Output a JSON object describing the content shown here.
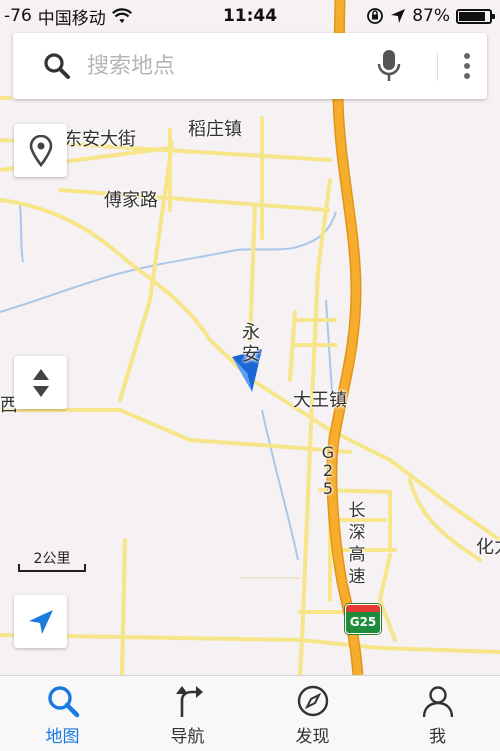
{
  "status_bar": {
    "signal": "-76",
    "carrier": "中国移动",
    "time": "11:44",
    "battery_percent": "87%",
    "battery_level": 0.87,
    "icons": [
      "wifi-icon",
      "rotation-lock-icon",
      "location-arrow-icon",
      "battery-icon"
    ]
  },
  "search": {
    "placeholder": "搜索地点",
    "value": ""
  },
  "scale": {
    "label": "2公里"
  },
  "map": {
    "labels": {
      "dongan_street": "东安大街",
      "daozhuang_town": "稻庄镇",
      "fujia_road": "傅家路",
      "yongan": "永安",
      "dawang_town": "大王镇",
      "xi_partial": "西",
      "hua_partial": "化力",
      "highway_name": "长深高速",
      "highway_code": "G25"
    },
    "shield": "G25"
  },
  "colors": {
    "map_background": "#f6f1f3",
    "road": "#f7e58a",
    "highway": "#f0a71c",
    "water": "#a9c8ea",
    "accent": "#1a7ae0"
  },
  "tabs": [
    {
      "label": "地图",
      "icon": "search-icon",
      "active": true
    },
    {
      "label": "导航",
      "icon": "turn-arrow-icon",
      "active": false
    },
    {
      "label": "发现",
      "icon": "compass-icon",
      "active": false
    },
    {
      "label": "我",
      "icon": "user-icon",
      "active": false
    }
  ]
}
